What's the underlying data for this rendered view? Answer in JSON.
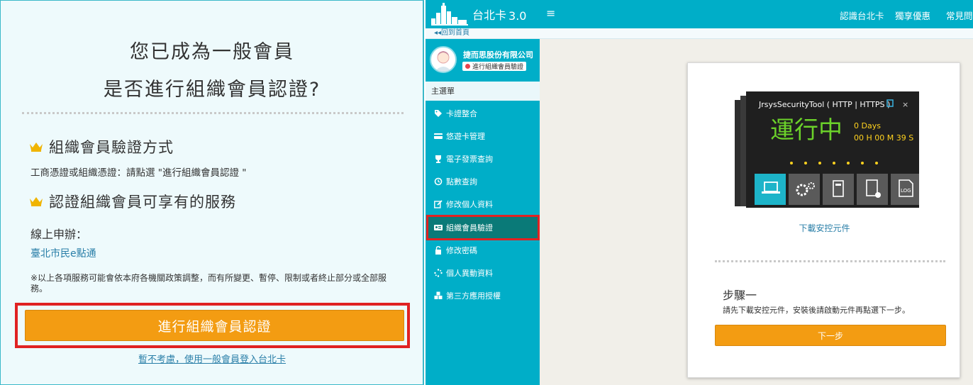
{
  "left": {
    "title_line1": "您已成為一般會員",
    "title_line2": "是否進行組織會員認證?",
    "section1_title": "組織會員驗證方式",
    "section1_text": "工商憑證或組織憑證：請點選 \"進行組織會員認證 \"",
    "section2_title": "認證組織會員可享有的服務",
    "online_label": "線上申辦：",
    "online_link": "臺北市民e點通",
    "note": "※以上各項服務可能會依本府各機關政策調整，而有所變更、暫停、限制或者終止部分或全部服務。",
    "verify_button": "進行組織會員認證",
    "skip_link": "暫不考慮，使用一般會員登入台北卡",
    "crown_color": "#f0b400",
    "accent_color": "#f39c12",
    "highlight_color": "#e02222"
  },
  "header": {
    "logo_text": "台北卡",
    "logo_version": "3.0",
    "menu_icon": "hamburger-icon",
    "nav": [
      "認識台北卡",
      "獨享優惠",
      "常見問題"
    ],
    "back_home": "◂◂回到首頁",
    "brand_color": "#00aec8"
  },
  "sidebar": {
    "company": "捷而思股份有限公司",
    "badge": "進行組織會員驗證",
    "main_menu": "主選單",
    "items": [
      {
        "icon": "tags-icon",
        "label": "卡證整合"
      },
      {
        "icon": "credit-card-icon",
        "label": "悠遊卡管理"
      },
      {
        "icon": "trophy-icon",
        "label": "電子發票查詢"
      },
      {
        "icon": "history-icon",
        "label": "點數查詢"
      },
      {
        "icon": "edit-icon",
        "label": "修改個人資料"
      },
      {
        "icon": "id-card-icon",
        "label": "組織會員驗證"
      },
      {
        "icon": "unlock-icon",
        "label": "修改密碼"
      },
      {
        "icon": "spinner-icon",
        "label": "個人異動資料"
      },
      {
        "icon": "cubes-icon",
        "label": "第三方應用授權"
      }
    ]
  },
  "card": {
    "tool_title": "JrsysSecurityTool ( HTTP | HTTPS )",
    "status": "運行中",
    "days": "0 Days",
    "time": "00 H 00 M 39 S",
    "download_link": "下載安控元件",
    "step_title": "步驟一",
    "step_desc": "請先下載安控元件，安裝後請啟動元件再點選下一步。",
    "next_button": "下一步"
  }
}
